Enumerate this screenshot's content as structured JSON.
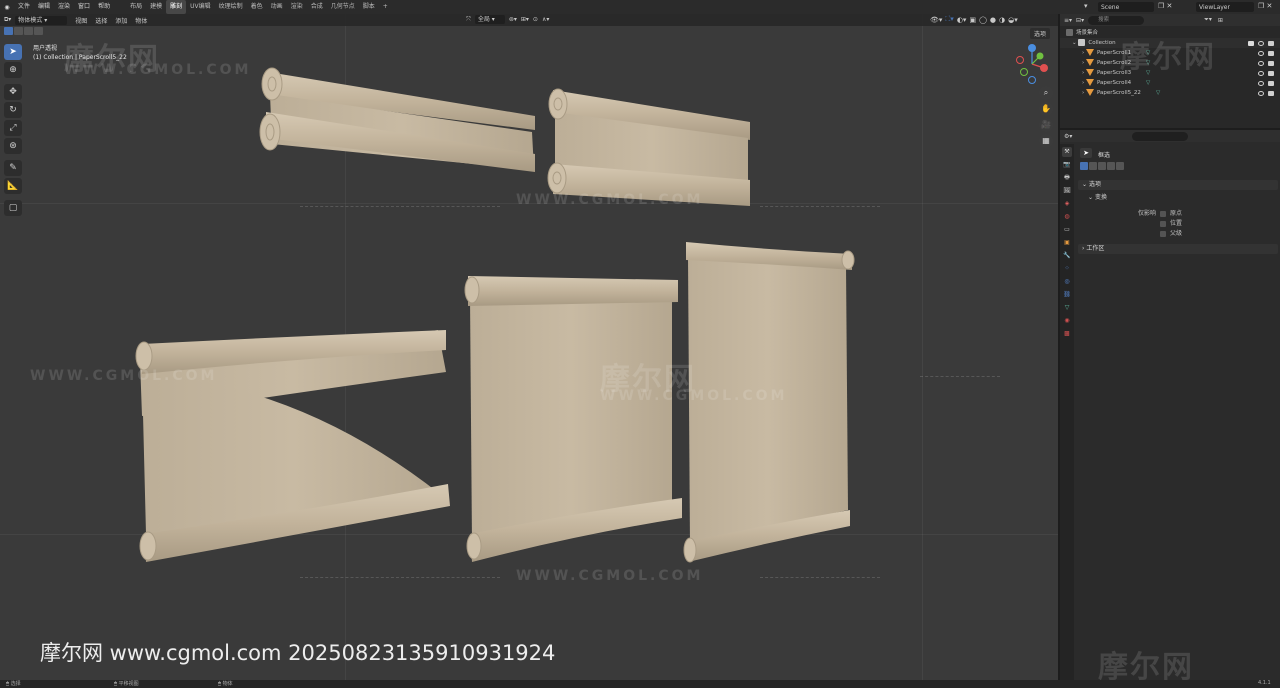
{
  "topbar": {
    "menus": [
      "文件",
      "编辑",
      "渲染",
      "窗口",
      "帮助"
    ],
    "workspaces": [
      "布局",
      "建模",
      "雕刻",
      "UV编辑",
      "纹理绘制",
      "着色",
      "动画",
      "渲染",
      "合成",
      "几何节点",
      "脚本"
    ],
    "active_workspace": "雕刻",
    "add_tab": "+",
    "scene": "Scene",
    "view_layer": "ViewLayer"
  },
  "viewport": {
    "mode": "物体模式",
    "menus": [
      "视图",
      "选择",
      "添加",
      "物体"
    ],
    "transform_orientation": "全局",
    "options_label": "选项",
    "view_name": "用户透视",
    "context": "(1) Collection | PaperScroll5_22"
  },
  "watermarks": {
    "cn": "摩尔网",
    "url": "WWW.CGMOL.COM"
  },
  "footer": "摩尔网 www.cgmol.com 20250823135910931924",
  "outliner": {
    "root": "场景集合",
    "collection": "Collection",
    "items": [
      "PaperScroll1",
      "PaperScroll2",
      "PaperScroll3",
      "PaperScroll4",
      "PaperScroll5_22"
    ],
    "search_placeholder": "搜索"
  },
  "properties": {
    "search_placeholder": "",
    "tool_title": "框选",
    "sections": {
      "options": "选项",
      "transform": "变换",
      "affect_only": "仅影响",
      "origin": "原点",
      "location": "位置",
      "parent": "父级",
      "workspace": "工作区"
    }
  },
  "statusbar": {
    "left": "选择",
    "middle": "平移视图",
    "right": "物体",
    "version": "4.1.1"
  },
  "colors": {
    "viewport_bg": "#3a3a3a",
    "paper": "#c4b59e",
    "accent": "#4772b3",
    "mesh_icon": "#e59a3f"
  }
}
